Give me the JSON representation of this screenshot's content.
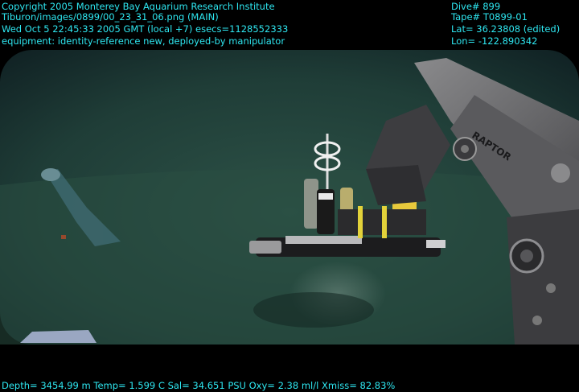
{
  "overlay": {
    "top_left": [
      "Copyright 2005 Monterey Bay Aquarium Research Institute",
      "Tiburon/images/0899/00_23_31_06.png (MAIN)",
      "Wed Oct  5 22:45:33 2005 GMT (local +7)  esecs=1128552333",
      "equipment: identity-reference new, deployed-by manipulator"
    ],
    "top_right": [
      "Dive# 899",
      "Tape# T0899-01",
      "Lat= 36.23808 (edited)",
      "Lon= -122.890342"
    ],
    "bottom": "Depth= 3454.99 m  Temp= 1.599 C  Sal= 34.651 PSU  Oxy= 2.38 ml/l  Xmiss= 82.83%"
  },
  "arm_label": "RAPTOR",
  "colors": {
    "overlay_text": "#2ee6f0",
    "water": "#23433b",
    "arm": "#6e6e70"
  }
}
